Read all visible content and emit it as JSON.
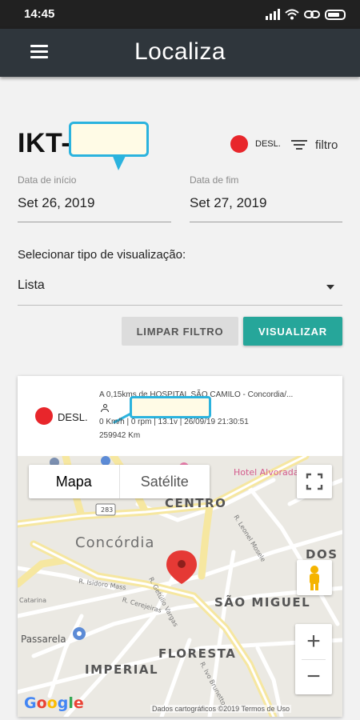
{
  "status_bar": {
    "time": "14:45"
  },
  "app_bar": {
    "title": "Localiza"
  },
  "header": {
    "vehicle_id": "IKT-",
    "status_label": "DESL.",
    "filter_label": "filtro"
  },
  "dates": {
    "start_label": "Data de início",
    "start_value": "Set 26, 2019",
    "end_label": "Data de fim",
    "end_value": "Set 27, 2019"
  },
  "view_type": {
    "label": "Selecionar tipo de visualização:",
    "selected": "Lista"
  },
  "buttons": {
    "clear": "LIMPAR FILTRO",
    "view": "VISUALIZAR"
  },
  "record": {
    "status_label": "DESL.",
    "address": "A 0,15kms de HOSPITAL SÃO CAMILO - Concordia/...",
    "telemetry": "0 Km/h | 0 rpm | 13.1v | 26/09/19 21:30:51",
    "odometer": "259942 Km"
  },
  "map": {
    "type_map": "Mapa",
    "type_satellite": "Satélite",
    "zoom_in": "+",
    "zoom_out": "−",
    "attribution": "Dados cartográficos ©2019   Termos de Uso",
    "labels": {
      "centro": "CENTRO",
      "concordia": "Concórdia",
      "sao_miguel": "SÃO MIGUEL",
      "floresta": "FLORESTA",
      "imperial": "IMPERIAL",
      "dos": "DOS",
      "hotel": "Hotel Alvorada",
      "passarela": "Passarela",
      "route": "283",
      "r_getulio": "R. Getúlio Vargas",
      "r_isidoro": "R. Isidoro Mass",
      "r_catarina": "Catarina",
      "r_cerejeiras": "R. Cerejeiras",
      "r_leonel": "R. Leonel Mosele",
      "r_ivo": "R. Ivo Brunetto"
    }
  },
  "colors": {
    "app_bar": "#2f363c",
    "status_red": "#e8262b",
    "accent_teal": "#26a69a",
    "pin_red": "#e53935"
  }
}
